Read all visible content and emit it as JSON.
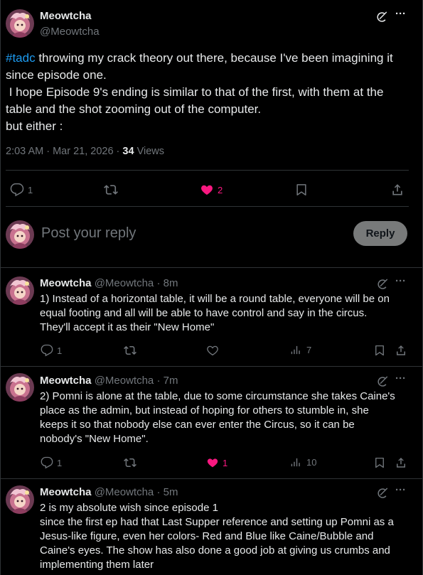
{
  "main_post": {
    "display_name": "Meowtcha",
    "handle": "@Meowtcha",
    "hashtag": "#tadc",
    "text_lines": [
      " throwing my crack theory out there, because I've been imagining it",
      "since episode one.",
      " I hope Episode 9's ending is similar to that of the first, with them at the",
      "table and the shot zooming out of the computer.",
      "but either :"
    ],
    "timestamp": "2:03 AM · Mar 21, 2026 · ",
    "views_count": "34",
    "views_label": " Views",
    "reply_count": "1",
    "like_count": "2"
  },
  "reply_box": {
    "placeholder": "Post your reply",
    "button_label": "Reply"
  },
  "replies": [
    {
      "display_name": "Meowtcha",
      "handle_time": "@Meowtcha · 8m",
      "lines": [
        "1) Instead of a horizontal table, it will be a round table, everyone will be on",
        "equal footing and all will be able to have control and say in the circus.",
        "They'll accept it as their \"New Home\""
      ],
      "reply_count": "1",
      "like_count": "",
      "views": "7",
      "liked": false
    },
    {
      "display_name": "Meowtcha",
      "handle_time": "@Meowtcha · 7m",
      "lines": [
        "2) Pomni is alone at the table, due to some circumstance she takes Caine's",
        "place as the admin, but instead of hoping for others to stumble in, she",
        "keeps it so that nobody else can ever enter the Circus, so it can be",
        "nobody's \"New Home\"."
      ],
      "reply_count": "1",
      "like_count": "1",
      "views": "10",
      "liked": true
    },
    {
      "display_name": "Meowtcha",
      "handle_time": "@Meowtcha · 5m",
      "lines": [
        "2 is my absolute wish since episode 1",
        "since the first ep had that Last Supper reference and setting up Pomni as a",
        "Jesus-like figure, even her colors- Red and Blue like Caine/Bubble and",
        "Caine's eyes. The show has also done a good job at giving us crumbs and",
        "implementing them later"
      ]
    }
  ],
  "icons": {
    "reply": "speech-bubble-icon",
    "repost": "repost-arrows-icon",
    "like": "heart-icon",
    "bookmark": "bookmark-icon",
    "share": "share-upload-icon",
    "views": "bar-chart-icon",
    "grok": "grok-slash-icon",
    "more": "ellipsis-icon"
  },
  "colors": {
    "background": "#000000",
    "text": "#e7e9ea",
    "muted": "#71767b",
    "hashtag": "#1d9bf0",
    "like": "#f91880",
    "divider": "#2f3336",
    "reply_button": "#787a7a"
  }
}
